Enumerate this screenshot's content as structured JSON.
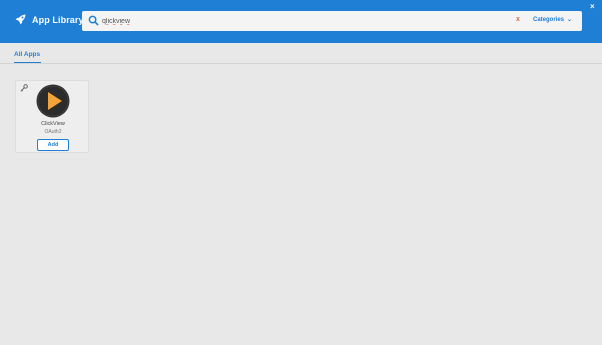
{
  "header": {
    "brand": "App Library",
    "search": {
      "value": "qlickview",
      "clear_label": "x"
    },
    "categories_label": "Categories",
    "close_label": "×"
  },
  "tabs": [
    {
      "label": "All Apps",
      "active": true
    }
  ],
  "apps": [
    {
      "name": "ClickView",
      "auth": "OAuth2",
      "add_label": "Add",
      "logo_icon": "play-icon",
      "badge_icon": "key-icon"
    }
  ],
  "colors": {
    "accent": "#1f7fd4",
    "background": "#e8e8e8",
    "logo_orange": "#f2a33a",
    "logo_dark": "#2c2c2c"
  }
}
